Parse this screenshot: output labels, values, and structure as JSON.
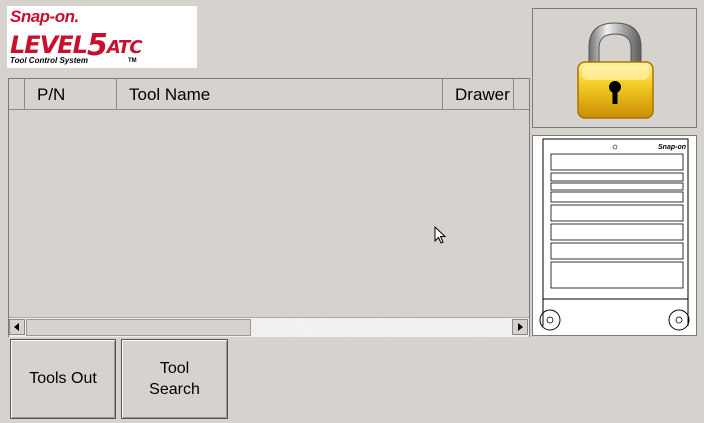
{
  "logo": {
    "brand": "Snap-on.",
    "product_prefix": "LEVEL",
    "product_number": "5",
    "product_suffix": "ATC",
    "tagline": "Tool Control System",
    "tm": "TM"
  },
  "grid": {
    "columns": [
      "P/N",
      "Tool Name",
      "Drawer"
    ],
    "rows": []
  },
  "buttons": {
    "tools_out": "Tools Out",
    "tool_search_line1": "Tool",
    "tool_search_line2": "Search"
  },
  "cabinet": {
    "brand": "Snap-on"
  },
  "status": {
    "lock_state": "locked",
    "lock_icon": "padlock-icon"
  },
  "colors": {
    "brand_red": "#c8102e",
    "lock_gold": "#f2c200",
    "background": "#d6d3ce"
  }
}
